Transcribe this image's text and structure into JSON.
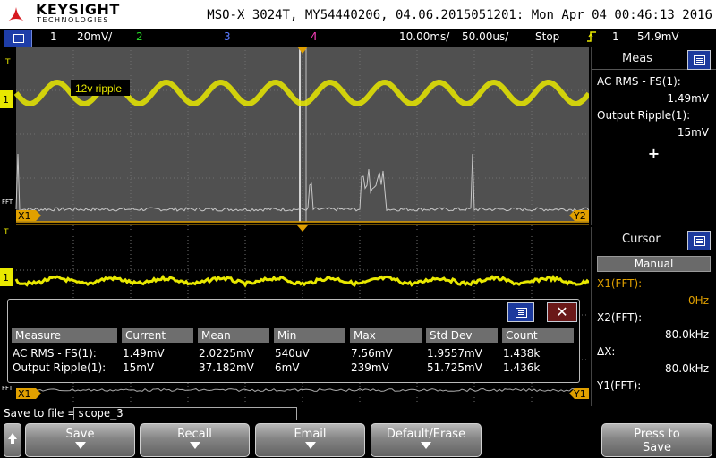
{
  "header": {
    "brand": "KEYSIGHT",
    "brand_sub": "TECHNOLOGIES",
    "scope_info": "MSO-X 3024T, MY54440206, 04.06.2015051201: Mon Apr 04 00:46:13 2016"
  },
  "channel_bar": {
    "ch1_num": "1",
    "ch1_scale": "20mV/",
    "ch2_num": "2",
    "ch3_num": "3",
    "ch4_num": "4",
    "timebase": "10.00ms/",
    "sample_rate": "50.00us/",
    "run_state": "Stop",
    "trigger_source": "1",
    "trigger_level": "54.9mV",
    "colors": {
      "ch1": "#e8e800",
      "ch2": "#27d927",
      "ch3": "#5a7bff",
      "ch4": "#ff3fbf"
    }
  },
  "waveform": {
    "label_12v": "12v ripple",
    "marker_x1": "X1",
    "marker_y2": "Y2",
    "marker_y1": "Y1",
    "marker_t": "T",
    "marker_fft": "FFT",
    "marker_ch1": "1"
  },
  "meas_panel": {
    "title": "Meas",
    "m1_label": "AC RMS - FS(1):",
    "m1_value": "1.49mV",
    "m2_label": "Output Ripple(1):",
    "m2_value": "15mV",
    "add_icon": "+"
  },
  "cursor_panel": {
    "title": "Cursor",
    "mode": "Manual",
    "x1_label": "X1(FFT):",
    "x1_value": "0Hz",
    "x2_label": "X2(FFT):",
    "x2_value": "80.0kHz",
    "dx_label": "ΔX:",
    "dx_value": "80.0kHz",
    "y1_label": "Y1(FFT):"
  },
  "stats": {
    "close_glyph": "✕",
    "columns": [
      "Measure",
      "Current",
      "Mean",
      "Min",
      "Max",
      "Std Dev",
      "Count"
    ],
    "rows": [
      [
        "AC RMS - FS(1):",
        "1.49mV",
        "2.0225mV",
        "540uV",
        "7.56mV",
        "1.9557mV",
        "1.438k"
      ],
      [
        "Output Ripple(1):",
        "15mV",
        "37.182mV",
        "6mV",
        "239mV",
        "51.725mV",
        "1.436k"
      ]
    ]
  },
  "savefile": {
    "label": "Save to file =",
    "value": "scope_3"
  },
  "softkeys": {
    "save": "Save",
    "recall": "Recall",
    "email": "Email",
    "default_erase": "Default/Erase",
    "press_to": "Press to",
    "save2": "Save"
  }
}
